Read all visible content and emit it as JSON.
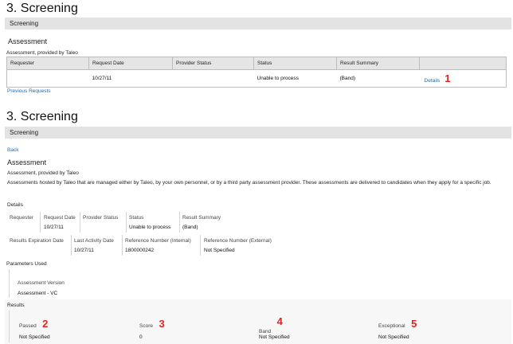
{
  "top": {
    "title": "3. Screening",
    "band": "Screening",
    "section": "Assessment",
    "provider": "Assessment, provided by Taleo",
    "table": {
      "headers": [
        "Requester",
        "Request Date",
        "Provider Status",
        "Status",
        "Result Summary",
        ""
      ],
      "row": [
        "",
        "10/27/11",
        "",
        "Unable to process",
        "(Band)",
        "Details"
      ]
    },
    "callout": "1",
    "previous_link": "Previous Requests"
  },
  "bottom": {
    "title": "3. Screening",
    "band": "Screening",
    "back_link": "Back",
    "section": "Assessment",
    "provider": "Assessment, provided by Taleo",
    "description": "Assessments hosted by Taleo that are managed either by Taleo, by your own personnel, or by a third party assessment provider. These assessments are delivered to candidates when they apply for a specific job.",
    "details_heading": "Details",
    "details_row1": [
      {
        "label": "Requester",
        "value": ""
      },
      {
        "label": "Request Date",
        "value": "10/27/11"
      },
      {
        "label": "Provider Status",
        "value": ""
      },
      {
        "label": "Status",
        "value": "Unable to process"
      },
      {
        "label": "Result Summary",
        "value": "(Band)"
      }
    ],
    "details_row2": [
      {
        "label": "Results Expiration Date",
        "value": ""
      },
      {
        "label": "Last Activity Date",
        "value": "10/27/11"
      },
      {
        "label": "Reference Number (Internal)",
        "value": "1800000242"
      },
      {
        "label": "Reference Number (External)",
        "value": "Not Specified"
      }
    ],
    "parameters_heading": "Parameters Used",
    "assessment_version_label": "Assessment Version",
    "assessment_version_value": "Assessment - VC",
    "results_heading": "Results",
    "results": [
      {
        "label": "Passed",
        "value": "Not Specified",
        "callout": "2"
      },
      {
        "label": "Score",
        "value": "0",
        "callout": "3"
      },
      {
        "label": "Band",
        "value": "Not Specified",
        "callout": "4"
      },
      {
        "label": "Exceptional",
        "value": "Not Specified",
        "callout": "5"
      }
    ]
  }
}
